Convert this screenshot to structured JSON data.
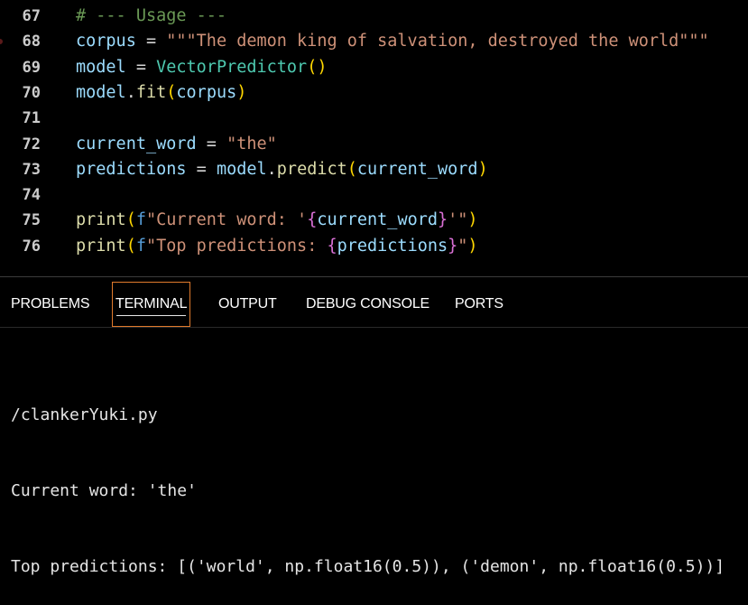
{
  "editor": {
    "lines": [
      {
        "num": "67",
        "parts": [
          {
            "t": "# --- Usage ---",
            "c": "comment"
          }
        ]
      },
      {
        "num": "68",
        "breakpoint": true,
        "parts": [
          {
            "t": "corpus",
            "c": "var"
          },
          {
            "t": " = ",
            "c": "op"
          },
          {
            "t": "\"\"\"The demon king of salvation, destroyed the world\"\"\"",
            "c": "str"
          }
        ]
      },
      {
        "num": "69",
        "parts": [
          {
            "t": "model",
            "c": "var"
          },
          {
            "t": " = ",
            "c": "op"
          },
          {
            "t": "VectorPredictor",
            "c": "cls"
          },
          {
            "t": "()",
            "c": "p1"
          }
        ]
      },
      {
        "num": "70",
        "parts": [
          {
            "t": "model",
            "c": "var"
          },
          {
            "t": ".",
            "c": "op"
          },
          {
            "t": "fit",
            "c": "fn"
          },
          {
            "t": "(",
            "c": "p1"
          },
          {
            "t": "corpus",
            "c": "var"
          },
          {
            "t": ")",
            "c": "p1"
          }
        ]
      },
      {
        "num": "71",
        "parts": []
      },
      {
        "num": "72",
        "parts": [
          {
            "t": "current_word",
            "c": "var"
          },
          {
            "t": " = ",
            "c": "op"
          },
          {
            "t": "\"the\"",
            "c": "str"
          }
        ]
      },
      {
        "num": "73",
        "parts": [
          {
            "t": "predictions",
            "c": "var"
          },
          {
            "t": " = ",
            "c": "op"
          },
          {
            "t": "model",
            "c": "var"
          },
          {
            "t": ".",
            "c": "op"
          },
          {
            "t": "predict",
            "c": "fn"
          },
          {
            "t": "(",
            "c": "p1"
          },
          {
            "t": "current_word",
            "c": "var"
          },
          {
            "t": ")",
            "c": "p1"
          }
        ]
      },
      {
        "num": "74",
        "parts": []
      },
      {
        "num": "75",
        "parts": [
          {
            "t": "print",
            "c": "fn"
          },
          {
            "t": "(",
            "c": "p1"
          },
          {
            "t": "f",
            "c": "kw"
          },
          {
            "t": "\"Current word: '",
            "c": "str"
          },
          {
            "t": "{",
            "c": "p2"
          },
          {
            "t": "current_word",
            "c": "var"
          },
          {
            "t": "}",
            "c": "p2"
          },
          {
            "t": "'\"",
            "c": "str"
          },
          {
            "t": ")",
            "c": "p1"
          }
        ]
      },
      {
        "num": "76",
        "parts": [
          {
            "t": "print",
            "c": "fn"
          },
          {
            "t": "(",
            "c": "p1"
          },
          {
            "t": "f",
            "c": "kw"
          },
          {
            "t": "\"Top predictions: ",
            "c": "str"
          },
          {
            "t": "{",
            "c": "p2"
          },
          {
            "t": "predictions",
            "c": "var"
          },
          {
            "t": "}",
            "c": "p2"
          },
          {
            "t": "\"",
            "c": "str"
          },
          {
            "t": ")",
            "c": "p1"
          }
        ]
      }
    ]
  },
  "panel": {
    "tabs": [
      {
        "label": "PROBLEMS",
        "id": "problems",
        "active": false
      },
      {
        "label": "TERMINAL",
        "id": "terminal",
        "active": true
      },
      {
        "label": "OUTPUT",
        "id": "output",
        "active": false
      },
      {
        "label": "DEBUG CONSOLE",
        "id": "debug-console",
        "active": false
      },
      {
        "label": "PORTS",
        "id": "ports",
        "active": false
      }
    ]
  },
  "terminal": {
    "lines": [
      "/clankerYuki.py",
      "Current word: 'the'",
      "Top predictions: [('world', np.float16(0.5)), ('demon', np.float16(0.5))]"
    ]
  },
  "colors": {
    "background": "#000000",
    "active_tab_border": "#e07a2c",
    "comment": "#6a9955",
    "string": "#ce9178",
    "variable": "#9cdcfe",
    "function": "#dcdcaa",
    "class": "#4ec9b0"
  }
}
